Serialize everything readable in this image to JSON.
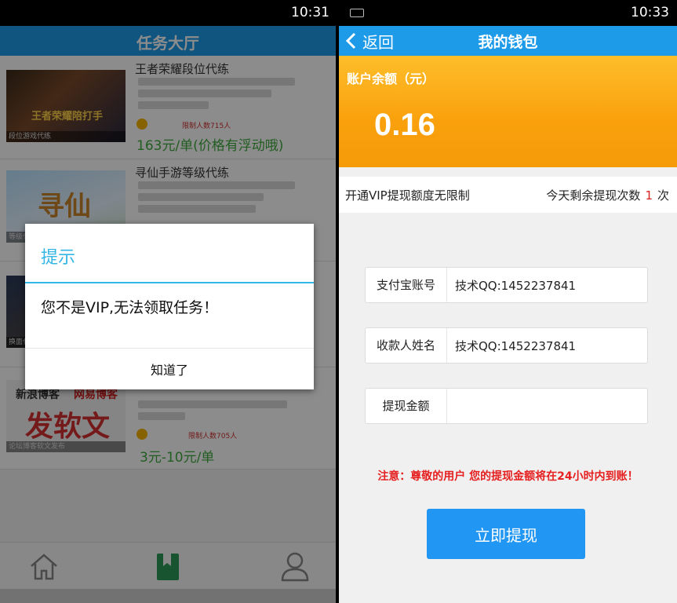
{
  "left_screen": {
    "status_time": "10:31",
    "header_title": "任务大厅",
    "tasks": [
      {
        "name": "王者荣耀段位代练",
        "thumb_logo": "王者荣耀陪打手",
        "thumb_caption": "段位游戏代练",
        "limit": "限制人数715人",
        "price": "163元/单(价格有浮动哦)"
      },
      {
        "name": "寻仙手游等级代练",
        "thumb_logo": "寻仙",
        "thumb_caption": "等级代练"
      },
      {
        "thumb_caption": "换面代练"
      },
      {
        "thumb_t1": "新浪博客",
        "thumb_t2": "网易博客",
        "thumb_t3": "发软文",
        "thumb_caption": "论坛博客软文发布",
        "limit": "限制人数705人",
        "price": "3元-10元/单"
      }
    ],
    "dialog": {
      "title": "提示",
      "message": "您不是VIP,无法领取任务！",
      "button": "知道了"
    },
    "tabs": [
      "home-icon",
      "bookmark-icon",
      "user-icon"
    ],
    "accent_color": "#1d9be8",
    "active_tab_color": "#2e9a5a"
  },
  "right_screen": {
    "status_time": "10:33",
    "back_label": "返回",
    "header_title": "我的钱包",
    "balance_label": "账户余额（元）",
    "balance_value": "0.16",
    "vip_text": "开通VIP提现额度无限制",
    "quota_prefix": "今天剩余提现次数",
    "quota_count": "1",
    "quota_suffix": "次",
    "fields": [
      {
        "label": "支付宝账号",
        "value": "技术QQ:1452237841"
      },
      {
        "label": "收款人姓名",
        "value": "技术QQ:1452237841"
      },
      {
        "label": "提现金额",
        "value": ""
      }
    ],
    "notice": "注意：尊敬的用户 您的提现金额将在24小时内到账！",
    "submit_label": "立即提现",
    "balance_color": "#f9a00c",
    "notice_color": "#e62020",
    "button_color": "#2196f3"
  }
}
